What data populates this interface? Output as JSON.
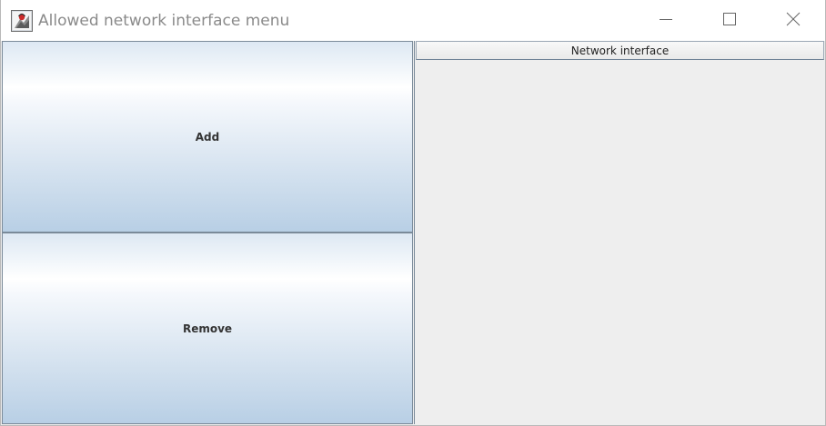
{
  "window": {
    "title": "Allowed network interface menu",
    "icon": "java-app-icon",
    "controls": {
      "minimize": "minimize-icon",
      "maximize": "maximize-icon",
      "close": "close-icon"
    }
  },
  "buttons": {
    "add_label": "Add",
    "remove_label": "Remove"
  },
  "table": {
    "columns": [
      "Network interface"
    ],
    "rows": []
  },
  "colors": {
    "button_gradient_top": "#ffffff",
    "button_gradient_bottom": "#b8cfe5",
    "panel_background": "#eeeeee",
    "title_text": "#8a8a8a"
  }
}
